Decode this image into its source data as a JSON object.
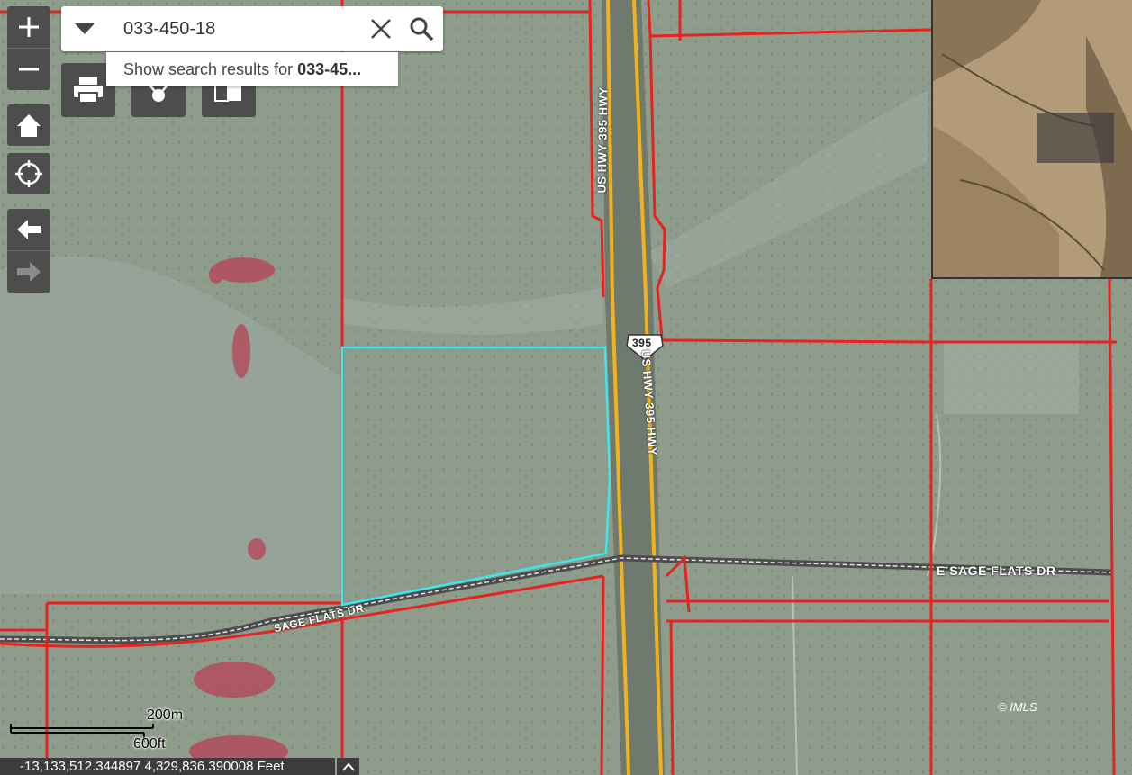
{
  "search": {
    "value": "033-450-18",
    "suggestion_prefix": "Show search results for ",
    "suggestion_term": "033-45..."
  },
  "labels": {
    "highway_north": "US HWY 395 HWY",
    "highway_south": "US HWY 395 HWY",
    "shield": "395",
    "road_west": "SAGE FLATS DR",
    "road_east": "E SAGE FLATS DR"
  },
  "scale": {
    "metric": "200m",
    "imperial": "600ft"
  },
  "coordinates": "-13,133,512.344897 4,329,836.390008 Feet",
  "copyright": "© IMLS",
  "icons": [
    "zoom-in-icon",
    "zoom-out-icon",
    "home-icon",
    "locate-icon",
    "back-arrow-icon",
    "forward-arrow-icon",
    "print-icon",
    "measure-icon",
    "compare-icon",
    "dropdown-icon",
    "clear-icon",
    "search-icon",
    "chevron-up-icon"
  ],
  "colors": {
    "parcel": "#e8231f",
    "selected_parcel": "#3ee6ee",
    "highway": "#f2b21a",
    "control_bg": "#4d4d4d"
  }
}
